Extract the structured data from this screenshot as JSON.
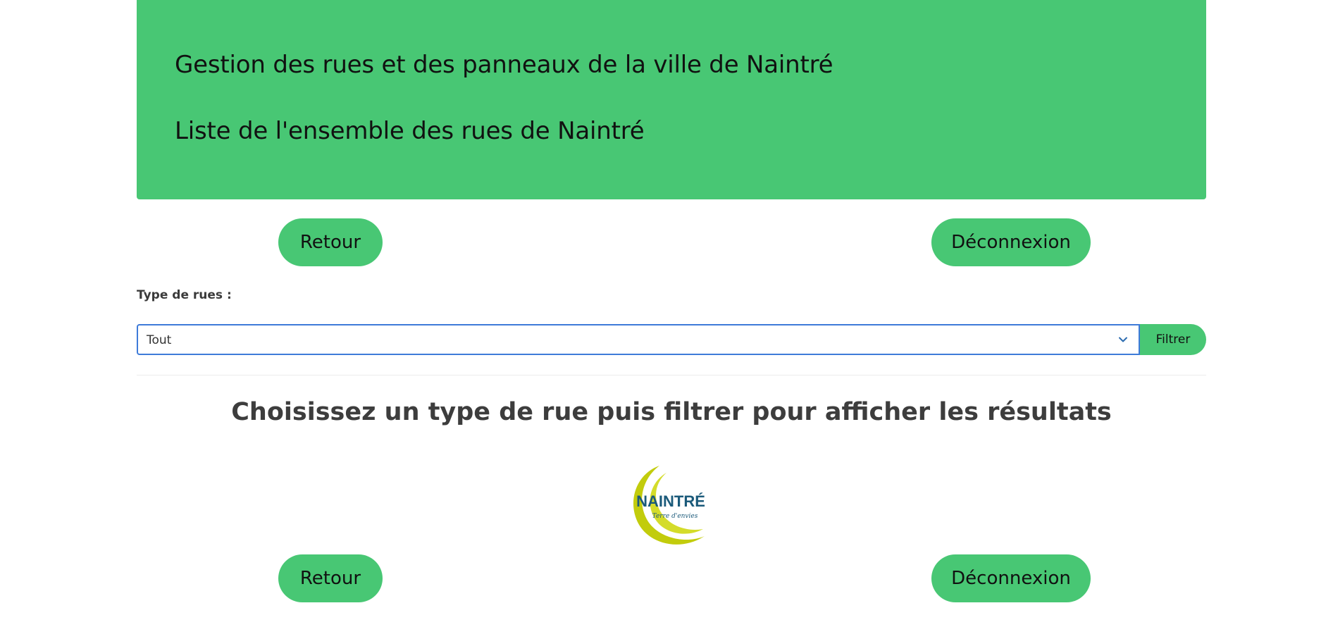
{
  "header": {
    "title": "Gestion des rues et des panneaux de la ville de Naintré",
    "subtitle": "Liste de l'ensemble des rues de Naintré"
  },
  "nav": {
    "back_label": "Retour",
    "logout_label": "Déconnexion"
  },
  "filter": {
    "label": "Type de rues :",
    "selected_value": "Tout",
    "submit_label": "Filtrer"
  },
  "results": {
    "empty_message": "Choisissez un type de rue puis filtrer pour afficher les résultats"
  },
  "logo": {
    "name": "NAINTRÉ",
    "tagline": "Terre d'envies"
  },
  "colors": {
    "accent": "#48c774",
    "select_border": "#3e7bd9",
    "logo_green": "#c2cc0c",
    "logo_blue": "#1b5a7a"
  },
  "icons": {
    "select_chevron": "chevron-down-icon"
  }
}
